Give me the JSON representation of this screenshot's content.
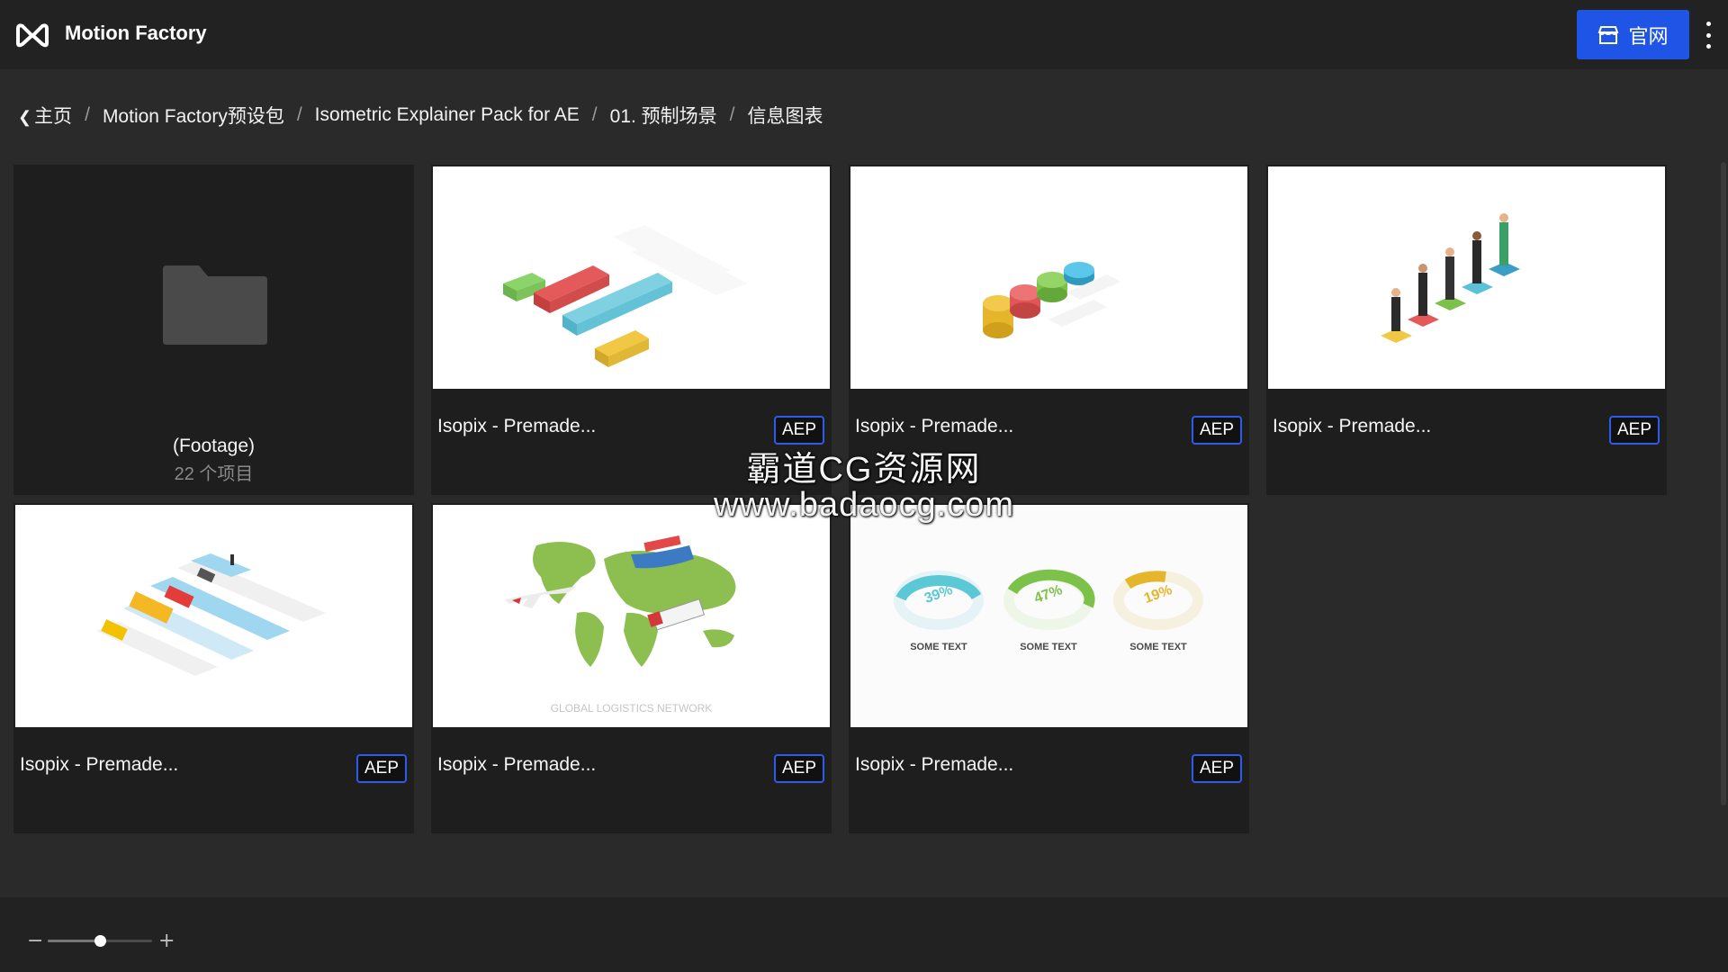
{
  "header": {
    "app_name": "Motion Factory",
    "official_button_label": "官网"
  },
  "breadcrumb": {
    "items": [
      "主页",
      "Motion Factory预设包",
      "Isometric Explainer Pack for AE",
      "01. 预制场景",
      "信息图表"
    ],
    "separator": "/"
  },
  "folder": {
    "name": "(Footage)",
    "count": "22 个项目"
  },
  "cards": [
    {
      "title": "Isopix - Premade...",
      "badge": "AEP",
      "thumb": "isometric-bar-chart"
    },
    {
      "title": "Isopix - Premade...",
      "badge": "AEP",
      "thumb": "isometric-cylinder-chart"
    },
    {
      "title": "Isopix - Premade...",
      "badge": "AEP",
      "thumb": "isometric-people-chart"
    },
    {
      "title": "Isopix - Premade...",
      "badge": "AEP",
      "thumb": "isometric-vehicles-chart"
    },
    {
      "title": "Isopix - Premade...",
      "badge": "AEP",
      "thumb": "logistics-world-map",
      "thumb_caption": "GLOBAL LOGISTICS NETWORK"
    },
    {
      "title": "Isopix - Premade...",
      "badge": "AEP",
      "thumb": "donut-percent-chart",
      "donuts": [
        {
          "percent": "39%",
          "label": "SOME TEXT",
          "color": "#5bc8d6"
        },
        {
          "percent": "47%",
          "label": "SOME TEXT",
          "color": "#7cc24a"
        },
        {
          "percent": "19%",
          "label": "SOME TEXT",
          "color": "#e5b62c"
        }
      ]
    }
  ],
  "watermark": {
    "line1": "霸道CG资源网",
    "line2": "www.badaocg.com"
  },
  "zoom": {
    "minus": "−",
    "plus": "+",
    "level": 0.5
  },
  "colors": {
    "accent": "#1f55e6",
    "badge_border": "#2f5bea",
    "background": "#2a2a2a",
    "card": "#1e1e1e"
  }
}
